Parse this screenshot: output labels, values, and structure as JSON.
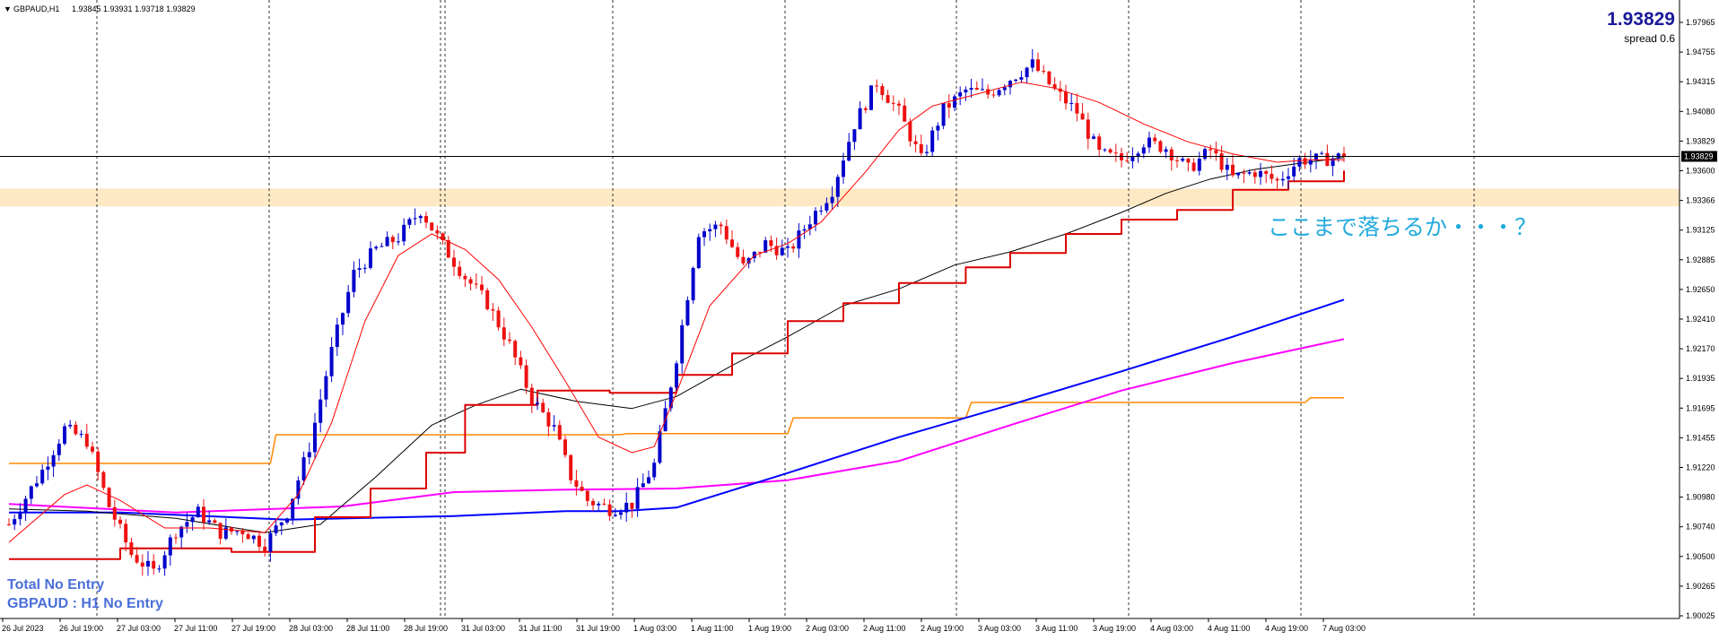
{
  "header": {
    "symbol_label": "GBPAUD,H1",
    "ohlc_text": "1.93845 1.93931 1.93718 1.93829",
    "current_price": "1.93829",
    "spread_text": "spread 0.6"
  },
  "status": {
    "total_text": "Total No Entry",
    "pair_text": "GBPAUD : H1 No Entry"
  },
  "annotation_text": "ここまで落ちるか・・・？",
  "price_tag": "1.93829",
  "colors": {
    "bull": "#0000cc",
    "bear": "#ee1111",
    "sma_fast": "#ff0000",
    "sma_slow": "#000000",
    "ma_blue": "#0000ff",
    "ma_magenta": "#ff00ff",
    "ma_orange": "#ff8800",
    "step_red": "#dd0000",
    "zone": "#fde9c4",
    "annotation": "#22aadd",
    "status_text": "#4a6fd8",
    "price_line": "#000000"
  },
  "chart_data": {
    "type": "candlestick",
    "symbol": "GBPAUD",
    "timeframe": "H1",
    "ylim": [
      1.9,
      1.9495
    ],
    "y_ticks": [
      "1.97965",
      "1.94755",
      "1.94315",
      "1.94080",
      "1.93829",
      "1.93600",
      "1.93366",
      "1.93125",
      "1.92885",
      "1.92650",
      "1.92410",
      "1.92170",
      "1.91935",
      "1.91695",
      "1.91455",
      "1.91220",
      "1.90980",
      "1.90740",
      "1.90500",
      "1.90265",
      "1.90025"
    ],
    "x_ticks": [
      "26 Jul 2023",
      "26 Jul 19:00",
      "27 Jul 03:00",
      "27 Jul 11:00",
      "27 Jul 19:00",
      "28 Jul 03:00",
      "28 Jul 11:00",
      "28 Jul 19:00",
      "31 Jul 03:00",
      "31 Jul 11:00",
      "31 Jul 19:00",
      "1 Aug 03:00",
      "1 Aug 11:00",
      "1 Aug 19:00",
      "2 Aug 03:00",
      "2 Aug 11:00",
      "2 Aug 19:00",
      "3 Aug 03:00",
      "3 Aug 11:00",
      "3 Aug 19:00",
      "4 Aug 03:00",
      "4 Aug 11:00",
      "4 Aug 19:00",
      "7 Aug 03:00"
    ],
    "zone": {
      "low": 1.9341,
      "high": 1.9356
    },
    "last_price": 1.93829,
    "close_path": [
      [
        0,
        1.9075
      ],
      [
        6,
        1.912
      ],
      [
        10,
        1.9155
      ],
      [
        14,
        1.9145
      ],
      [
        18,
        1.909
      ],
      [
        22,
        1.905
      ],
      [
        26,
        1.9035
      ],
      [
        30,
        1.907
      ],
      [
        34,
        1.9085
      ],
      [
        38,
        1.9068
      ],
      [
        42,
        1.907
      ],
      [
        46,
        1.9058
      ],
      [
        50,
        1.9085
      ],
      [
        54,
        1.914
      ],
      [
        58,
        1.922
      ],
      [
        62,
        1.9285
      ],
      [
        66,
        1.9305
      ],
      [
        70,
        1.9315
      ],
      [
        74,
        1.9338
      ],
      [
        78,
        1.9308
      ],
      [
        82,
        1.9282
      ],
      [
        86,
        1.926
      ],
      [
        90,
        1.9225
      ],
      [
        94,
        1.918
      ],
      [
        98,
        1.9155
      ],
      [
        101,
        1.9115
      ],
      [
        104,
        1.9095
      ],
      [
        108,
        1.9088
      ],
      [
        112,
        1.9092
      ],
      [
        116,
        1.9125
      ],
      [
        120,
        1.9215
      ],
      [
        124,
        1.932
      ],
      [
        128,
        1.9325
      ],
      [
        132,
        1.929
      ],
      [
        136,
        1.931
      ],
      [
        140,
        1.9302
      ],
      [
        144,
        1.933
      ],
      [
        148,
        1.9355
      ],
      [
        152,
        1.941
      ],
      [
        156,
        1.9445
      ],
      [
        160,
        1.942
      ],
      [
        164,
        1.938
      ],
      [
        168,
        1.9422
      ],
      [
        172,
        1.9438
      ],
      [
        176,
        1.9435
      ],
      [
        180,
        1.9448
      ],
      [
        184,
        1.946
      ],
      [
        188,
        1.9438
      ],
      [
        192,
        1.942
      ],
      [
        196,
        1.9385
      ],
      [
        200,
        1.938
      ],
      [
        204,
        1.9395
      ],
      [
        208,
        1.939
      ],
      [
        212,
        1.9372
      ],
      [
        216,
        1.9388
      ],
      [
        220,
        1.9365
      ],
      [
        224,
        1.937
      ],
      [
        228,
        1.9362
      ],
      [
        232,
        1.938
      ],
      [
        236,
        1.938
      ],
      [
        240,
        1.9383
      ]
    ],
    "sma_fast": [
      [
        0,
        1.906
      ],
      [
        10,
        1.91
      ],
      [
        14,
        1.9108
      ],
      [
        20,
        1.9095
      ],
      [
        28,
        1.9072
      ],
      [
        36,
        1.9072
      ],
      [
        46,
        1.9068
      ],
      [
        52,
        1.91
      ],
      [
        58,
        1.916
      ],
      [
        64,
        1.9245
      ],
      [
        70,
        1.93
      ],
      [
        76,
        1.9318
      ],
      [
        82,
        1.9305
      ],
      [
        88,
        1.928
      ],
      [
        94,
        1.924
      ],
      [
        100,
        1.9195
      ],
      [
        106,
        1.9148
      ],
      [
        112,
        1.9135
      ],
      [
        116,
        1.914
      ],
      [
        120,
        1.9185
      ],
      [
        126,
        1.9258
      ],
      [
        134,
        1.93
      ],
      [
        140,
        1.931
      ],
      [
        146,
        1.9328
      ],
      [
        154,
        1.937
      ],
      [
        160,
        1.9405
      ],
      [
        166,
        1.9425
      ],
      [
        174,
        1.9435
      ],
      [
        182,
        1.9445
      ],
      [
        188,
        1.944
      ],
      [
        196,
        1.9428
      ],
      [
        204,
        1.941
      ],
      [
        212,
        1.9395
      ],
      [
        220,
        1.9385
      ],
      [
        228,
        1.9378
      ],
      [
        234,
        1.938
      ],
      [
        240,
        1.938
      ]
    ],
    "sma_slow": [
      [
        0,
        1.9088
      ],
      [
        14,
        1.9086
      ],
      [
        30,
        1.908
      ],
      [
        46,
        1.9068
      ],
      [
        56,
        1.9075
      ],
      [
        66,
        1.9115
      ],
      [
        76,
        1.9158
      ],
      [
        84,
        1.9175
      ],
      [
        92,
        1.9188
      ],
      [
        102,
        1.9178
      ],
      [
        112,
        1.9172
      ],
      [
        120,
        1.9182
      ],
      [
        130,
        1.9208
      ],
      [
        140,
        1.9232
      ],
      [
        150,
        1.9258
      ],
      [
        160,
        1.9272
      ],
      [
        170,
        1.9292
      ],
      [
        180,
        1.9303
      ],
      [
        190,
        1.9318
      ],
      [
        200,
        1.9336
      ],
      [
        208,
        1.9352
      ],
      [
        216,
        1.9364
      ],
      [
        224,
        1.9372
      ],
      [
        232,
        1.9377
      ],
      [
        240,
        1.9382
      ]
    ],
    "ma_blue": [
      [
        0,
        1.9085
      ],
      [
        20,
        1.9085
      ],
      [
        50,
        1.9079
      ],
      [
        80,
        1.9082
      ],
      [
        100,
        1.9086
      ],
      [
        110,
        1.9086
      ],
      [
        120,
        1.9089
      ],
      [
        140,
        1.9118
      ],
      [
        160,
        1.9148
      ],
      [
        180,
        1.9175
      ],
      [
        200,
        1.9203
      ],
      [
        220,
        1.9232
      ],
      [
        240,
        1.9263
      ]
    ],
    "ma_magenta": [
      [
        0,
        1.9092
      ],
      [
        30,
        1.9085
      ],
      [
        60,
        1.909
      ],
      [
        80,
        1.9102
      ],
      [
        100,
        1.9104
      ],
      [
        120,
        1.9105
      ],
      [
        140,
        1.9112
      ],
      [
        160,
        1.9128
      ],
      [
        180,
        1.9158
      ],
      [
        200,
        1.9187
      ],
      [
        220,
        1.921
      ],
      [
        240,
        1.923
      ]
    ],
    "ma_orange": [
      [
        0,
        1.9126
      ],
      [
        47,
        1.9126
      ],
      [
        48,
        1.915
      ],
      [
        110,
        1.915
      ],
      [
        111,
        1.9151
      ],
      [
        140,
        1.9151
      ],
      [
        141,
        1.9164
      ],
      [
        172,
        1.9164
      ],
      [
        173,
        1.9177
      ],
      [
        233,
        1.9177
      ],
      [
        234,
        1.9181
      ],
      [
        240,
        1.9181
      ]
    ],
    "step_red": [
      [
        0,
        1.9046
      ],
      [
        20,
        1.9055
      ],
      [
        40,
        1.9052
      ],
      [
        55,
        1.9081
      ],
      [
        65,
        1.9105
      ],
      [
        75,
        1.9135
      ],
      [
        82,
        1.9175
      ],
      [
        95,
        1.9187
      ],
      [
        108,
        1.9185
      ],
      [
        120,
        1.92
      ],
      [
        130,
        1.9218
      ],
      [
        140,
        1.9245
      ],
      [
        150,
        1.926
      ],
      [
        160,
        1.9277
      ],
      [
        172,
        1.929
      ],
      [
        180,
        1.9302
      ],
      [
        190,
        1.9318
      ],
      [
        200,
        1.933
      ],
      [
        210,
        1.9338
      ],
      [
        220,
        1.9355
      ],
      [
        230,
        1.9362
      ],
      [
        240,
        1.9371
      ]
    ]
  }
}
